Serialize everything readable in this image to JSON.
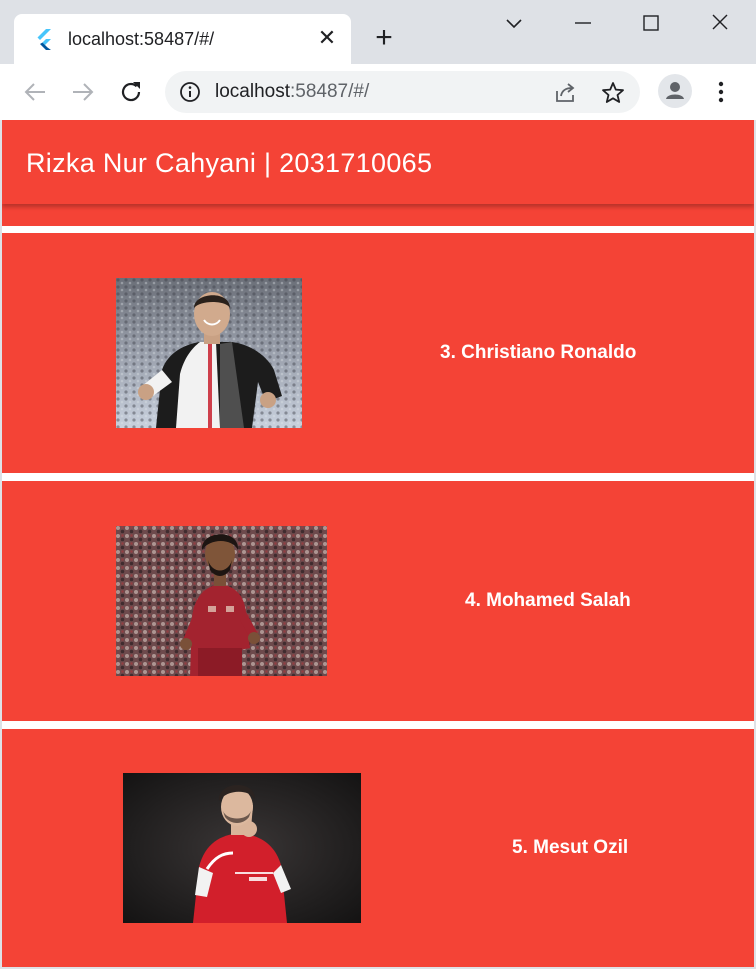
{
  "browser": {
    "tab_title": "localhost:58487/#/",
    "url_host": "localhost",
    "url_rest": ":58487/#/",
    "accent": "#f44336"
  },
  "app": {
    "title": "Rizka Nur Cahyani | 2031710065"
  },
  "players": [
    {
      "label": "3. Christiano Ronaldo",
      "kit": "juventus"
    },
    {
      "label": "4. Mohamed Salah",
      "kit": "liverpool"
    },
    {
      "label": "5. Mesut Ozil",
      "kit": "arsenal"
    }
  ]
}
